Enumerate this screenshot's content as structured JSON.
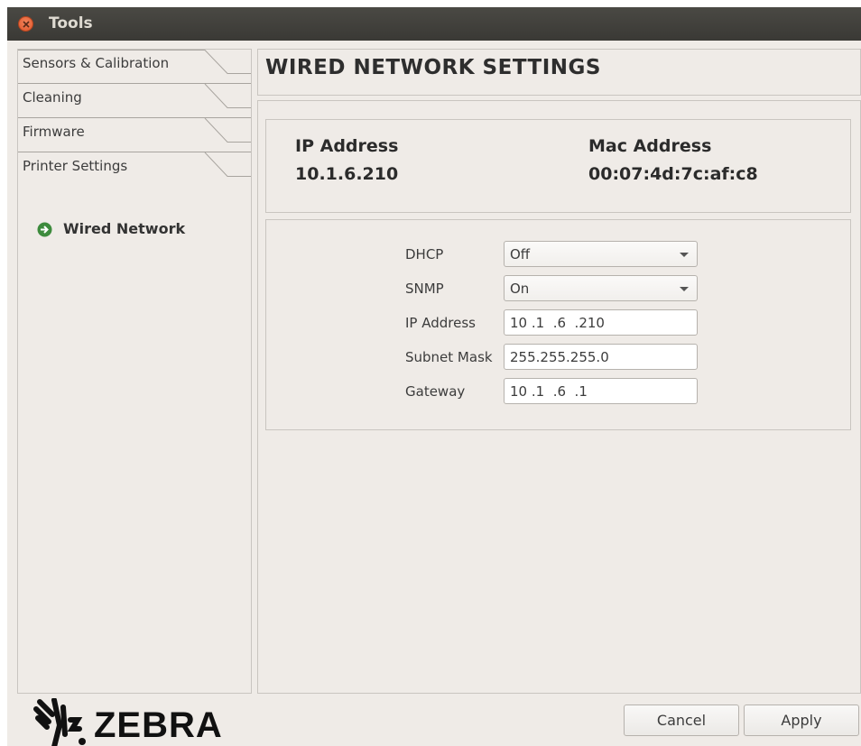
{
  "window": {
    "title": "Tools"
  },
  "sidebar": {
    "tabs": [
      {
        "label": "Sensors & Calibration"
      },
      {
        "label": "Cleaning"
      },
      {
        "label": "Firmware"
      },
      {
        "label": "Printer Settings"
      }
    ],
    "sub_items": [
      {
        "label": "Wired Network",
        "icon": "arrow-circle-icon"
      }
    ]
  },
  "page": {
    "title": "WIRED NETWORK SETTINGS"
  },
  "info": {
    "ip_heading": "IP Address",
    "ip_value": "10.1.6.210",
    "mac_heading": "Mac Address",
    "mac_value": "00:07:4d:7c:af:c8"
  },
  "form": {
    "dhcp_label": "DHCP",
    "dhcp_value": "Off",
    "snmp_label": "SNMP",
    "snmp_value": "On",
    "ip_label": "IP Address",
    "ip_value": "10 .1  .6  .210",
    "subnet_label": "Subnet Mask",
    "subnet_value": "255.255.255.0",
    "gateway_label": "Gateway",
    "gateway_value": "10 .1  .6  .1"
  },
  "footer": {
    "logo_text": "ZEBRA",
    "cancel_label": "Cancel",
    "apply_label": "Apply"
  },
  "colors": {
    "accent_green": "#3d8b3d",
    "close_orange": "#e1562a",
    "titlebar": "#3e3d39"
  }
}
